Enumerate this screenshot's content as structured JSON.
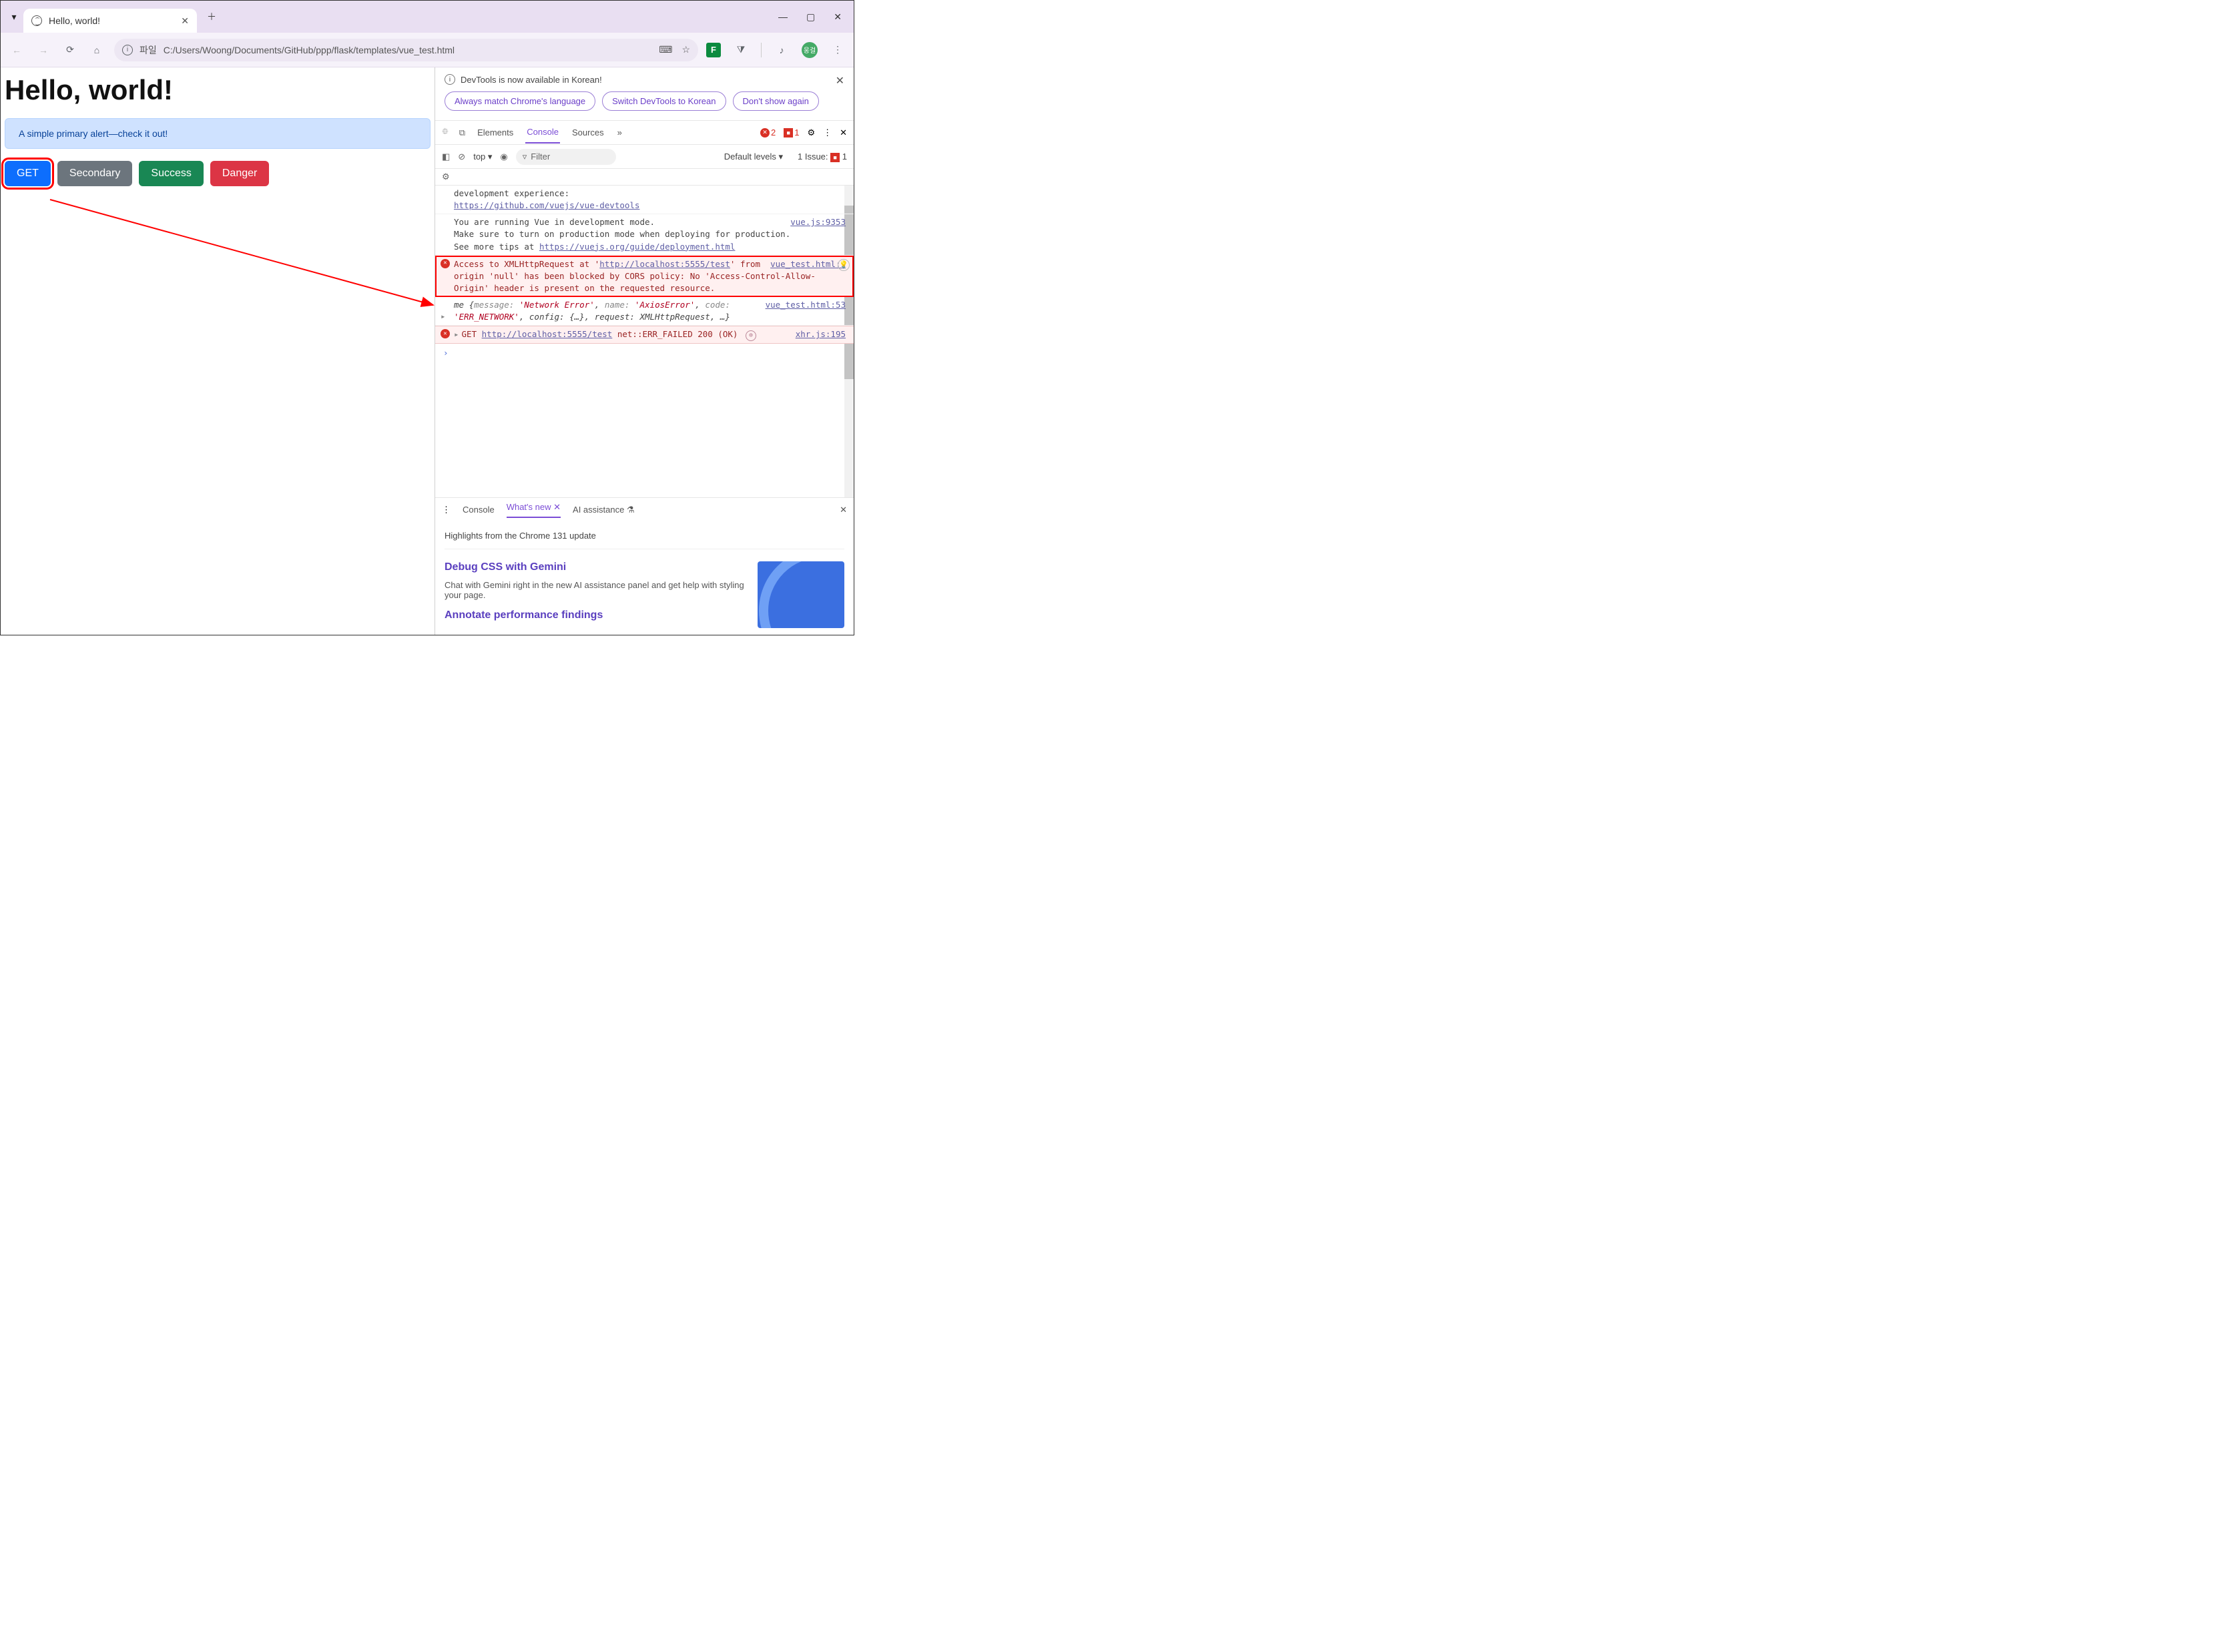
{
  "window": {
    "tab_title": "Hello, world!",
    "url_label": "파일",
    "url": "C:/Users/Woong/Documents/GitHub/ppp/flask/templates/vue_test.html"
  },
  "page": {
    "heading": "Hello, world!",
    "alert_text": "A simple primary alert—check it out!",
    "buttons": {
      "get": "GET",
      "secondary": "Secondary",
      "success": "Success",
      "danger": "Danger"
    }
  },
  "devtools": {
    "banner": {
      "title": "DevTools is now available in Korean!",
      "pill_match": "Always match Chrome's language",
      "pill_switch": "Switch DevTools to Korean",
      "pill_dont": "Don't show again"
    },
    "tabs": {
      "elements": "Elements",
      "console": "Console",
      "sources": "Sources",
      "more": "»"
    },
    "counts": {
      "errors": "2",
      "issues": "1",
      "issue_label": "1 Issue:",
      "issue_count": "1"
    },
    "toolbar": {
      "context": "top",
      "filter_placeholder": "Filter",
      "levels": "Default levels"
    },
    "console": {
      "dev_experience": "development experience:",
      "vue_devtools_url": "https://github.com/vuejs/vue-devtools",
      "vue_dev_mode_1": "You are running Vue in development mode.",
      "vue_dev_mode_2": "Make sure to turn on production mode when deploying for production.",
      "vue_dev_mode_3": "See more tips at ",
      "vue_deploy_url": "https://vuejs.org/guide/deployment.html",
      "vue_src": "vue.js:9353",
      "cors_src": "vue_test.html:1",
      "cors_1": "Access to XMLHttpRequest at '",
      "cors_url": "http://localhost:5555/test",
      "cors_2": "' from origin 'null' has been blocked by CORS policy: No 'Access-Control-Allow-Origin' header is present on the requested resource.",
      "axios_src": "vue_test.html:53",
      "axios_obj_prefix": "me ",
      "axios_msg_key": "message:",
      "axios_msg_val": "'Network Error'",
      "axios_name_key": "name:",
      "axios_name_val": "'AxiosError'",
      "axios_code_key": "code:",
      "axios_code_val": "'ERR_NETWORK'",
      "axios_rest": ", config: {…}, request: XMLHttpRequest, …}",
      "xhr_err_1": "GET ",
      "xhr_err_url": "http://localhost:5555/test",
      "xhr_err_2": " net::ERR_FAILED 200 (OK)",
      "xhr_src": "xhr.js:195"
    },
    "bottom_tabs": {
      "console": "Console",
      "whatsnew": "What's new",
      "ai": "AI assistance"
    },
    "whatsnew": {
      "highlights": "Highlights from the Chrome 131 update",
      "card1_h": "Debug CSS with Gemini",
      "card1_p": "Chat with Gemini right in the new AI assistance panel and get help with styling your page.",
      "card2_h": "Annotate performance findings"
    }
  },
  "ext": {
    "green_label": "F",
    "avatar_text": "웅걸"
  }
}
